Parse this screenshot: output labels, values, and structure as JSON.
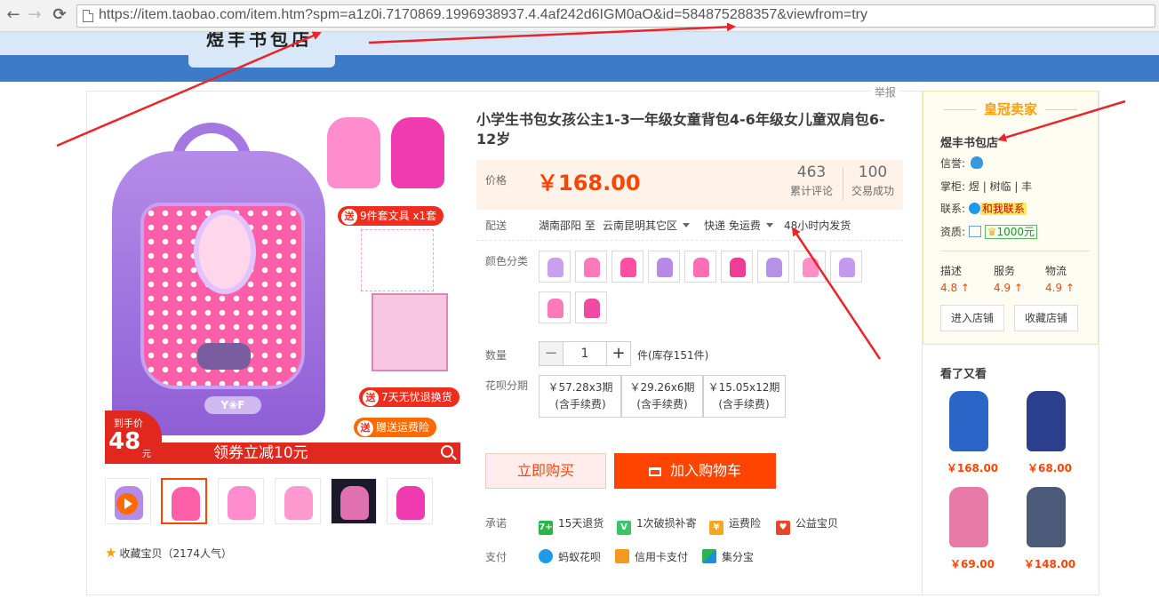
{
  "browser": {
    "back": "←",
    "forward": "→",
    "reload": "⟳",
    "url": "https://item.taobao.com/item.htm?spm=a1z0i.7170869.1996938937.4.4af242d6IGM0aO&id=584875288357&viewfrom=try"
  },
  "report_label": "举报",
  "gallery": {
    "tags": [
      "9件套文具 x1套",
      "7天无忧退换货",
      "赠送运费险"
    ],
    "tag_prefix": "送",
    "bag_logo": "Y❀F",
    "price_badge_label": "到手价",
    "price_badge_value": "48",
    "price_badge_unit": "元",
    "coupon_text": "领券立减10元",
    "favorite": "收藏宝贝（2174人气）"
  },
  "product": {
    "title": "小学生书包女孩公主1-3一年级女童背包4-6年级女儿童双肩包6-12岁",
    "price_label": "价格",
    "price": "￥168.00",
    "reviews_count": "463",
    "reviews_label": "累计评论",
    "sales_count": "100",
    "sales_label": "交易成功",
    "shipping_label": "配送",
    "shipping_from": "湖南邵阳 至",
    "shipping_to": "云南昆明其它区",
    "shipping_method": "快递 免运费",
    "shipping_time": "48小时内发货",
    "color_label": "颜色分类",
    "swatch_colors": [
      "#c9a0f0",
      "#ff7ab8",
      "#ff4fa0",
      "#b88ae6",
      "#ff6eb4",
      "#ee3d95",
      "#b591e8",
      "#ff8fc6",
      "#c49af0",
      "#ff79bb",
      "#f04aa2"
    ],
    "quantity_label": "数量",
    "quantity_minus": "−",
    "quantity_value": "1",
    "quantity_plus": "+",
    "stock": "件(库存151件)",
    "installment_label": "花呗分期",
    "installments": [
      {
        "line1": "￥57.28x3期",
        "line2": "(含手续费)"
      },
      {
        "line1": "￥29.26x6期",
        "line2": "(含手续费)"
      },
      {
        "line1": "￥15.05x12期",
        "line2": "(含手续费)"
      }
    ],
    "buy_now": "立即购买",
    "add_to_cart": "加入购物车",
    "promise_label": "承诺",
    "promises": [
      "15天退货",
      "1次破损补寄",
      "运费险",
      "公益宝贝"
    ],
    "promise_icons": [
      "7+",
      "V",
      "¥",
      "♥"
    ],
    "payment_label": "支付",
    "payments": [
      "蚂蚁花呗",
      "信用卡支付",
      "集分宝"
    ]
  },
  "shop": {
    "badge": "皇冠卖家",
    "name": "煜丰书包店",
    "credit_label": "信誉:",
    "keeper_label": "掌柜:",
    "keeper_value": "煜 | 树临 | 丰",
    "contact_label": "联系:",
    "contact_button": "和我联系",
    "qualification_label": "资质:",
    "deposit": "1000元",
    "ratings": [
      {
        "label": "描述",
        "value": "4.8 ↑"
      },
      {
        "label": "服务",
        "value": "4.9 ↑"
      },
      {
        "label": "物流",
        "value": "4.9 ↑"
      }
    ],
    "enter_shop": "进入店铺",
    "favorite_shop": "收藏店铺",
    "see_also_title": "看了又看",
    "recommendations": [
      {
        "price": "￥168.00",
        "color": "#2a66c8"
      },
      {
        "price": "￥68.00",
        "color": "#2b3f8e"
      },
      {
        "price": "￥69.00",
        "color": "#e87aa8"
      },
      {
        "price": "￥148.00",
        "color": "#4a5a78"
      }
    ]
  },
  "colors": {
    "accent": "#ff4400",
    "price": "#ff4400",
    "annotation": "#e8262a",
    "header_blue": "#3d7bc8"
  }
}
